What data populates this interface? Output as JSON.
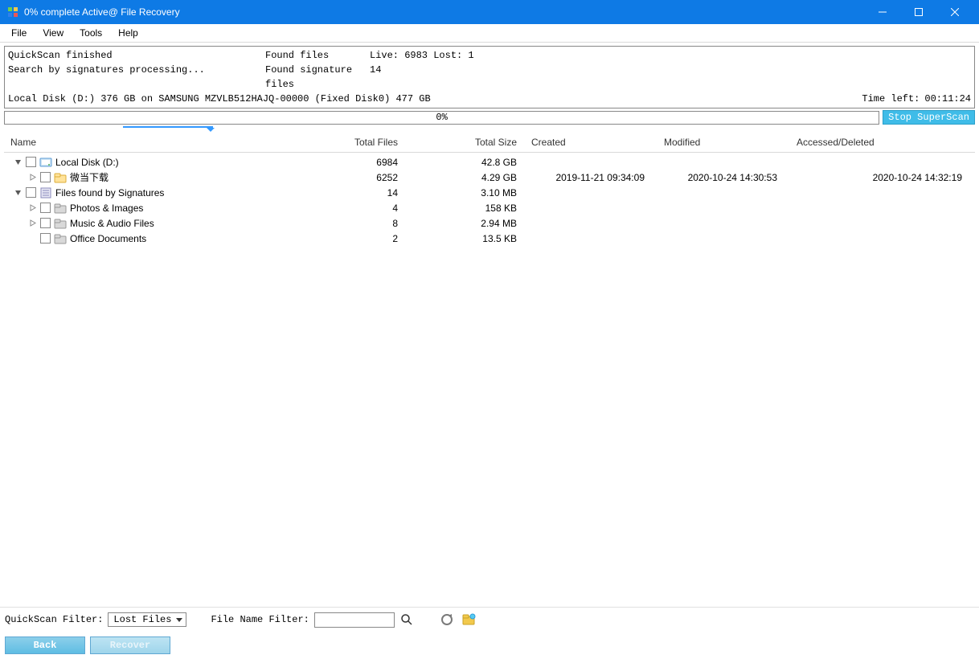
{
  "window": {
    "title": "0% complete Active@ File Recovery"
  },
  "menu": {
    "file": "File",
    "view": "View",
    "tools": "Tools",
    "help": "Help"
  },
  "status": {
    "line1_c1": "QuickScan finished",
    "line1_c2": "Found files",
    "line1_c3": "Live: 6983 Lost: 1",
    "line2_c1": "Search by signatures processing...",
    "line2_c2": "Found signature files",
    "line2_c3": "14",
    "line3": "Local Disk (D:) 376 GB on SAMSUNG MZVLB512HAJQ-00000 (Fixed Disk0) 477 GB",
    "time_left_label": "Time left:",
    "time_left_value": "00:11:24",
    "progress_text": "0%",
    "stop_btn": "Stop SuperScan"
  },
  "columns": {
    "name": "Name",
    "total_files": "Total Files",
    "total_size": "Total Size",
    "created": "Created",
    "modified": "Modified",
    "accessed": "Accessed/Deleted"
  },
  "rows": [
    {
      "indent": 0,
      "exp": "down",
      "icon": "disk",
      "name": "Local Disk (D:)",
      "files": "6984",
      "size": "42.8 GB",
      "created": "",
      "modified": "",
      "accessed": ""
    },
    {
      "indent": 1,
      "exp": "right",
      "icon": "folder",
      "name": "微当下载",
      "files": "6252",
      "size": "4.29 GB",
      "created": "2019-11-21 09:34:09",
      "modified": "2020-10-24 14:30:53",
      "accessed": "2020-10-24 14:32:19"
    },
    {
      "indent": 0,
      "exp": "down",
      "icon": "sigs",
      "name": "Files found by Signatures",
      "files": "14",
      "size": "3.10 MB",
      "created": "",
      "modified": "",
      "accessed": ""
    },
    {
      "indent": 1,
      "exp": "right",
      "icon": "filefolder",
      "name": "Photos & Images",
      "files": "4",
      "size": "158 KB",
      "created": "",
      "modified": "",
      "accessed": ""
    },
    {
      "indent": 1,
      "exp": "right",
      "icon": "filefolder",
      "name": "Music & Audio Files",
      "files": "8",
      "size": "2.94 MB",
      "created": "",
      "modified": "",
      "accessed": ""
    },
    {
      "indent": 1,
      "exp": "none",
      "icon": "filefolder",
      "name": "Office Documents",
      "files": "2",
      "size": "13.5 KB",
      "created": "",
      "modified": "",
      "accessed": ""
    }
  ],
  "filters": {
    "quickscan_label": "QuickScan Filter:",
    "quickscan_value": "Lost Files",
    "filename_label": "File Name Filter:",
    "filename_value": ""
  },
  "buttons": {
    "back": "Back",
    "recover": "Recover"
  }
}
